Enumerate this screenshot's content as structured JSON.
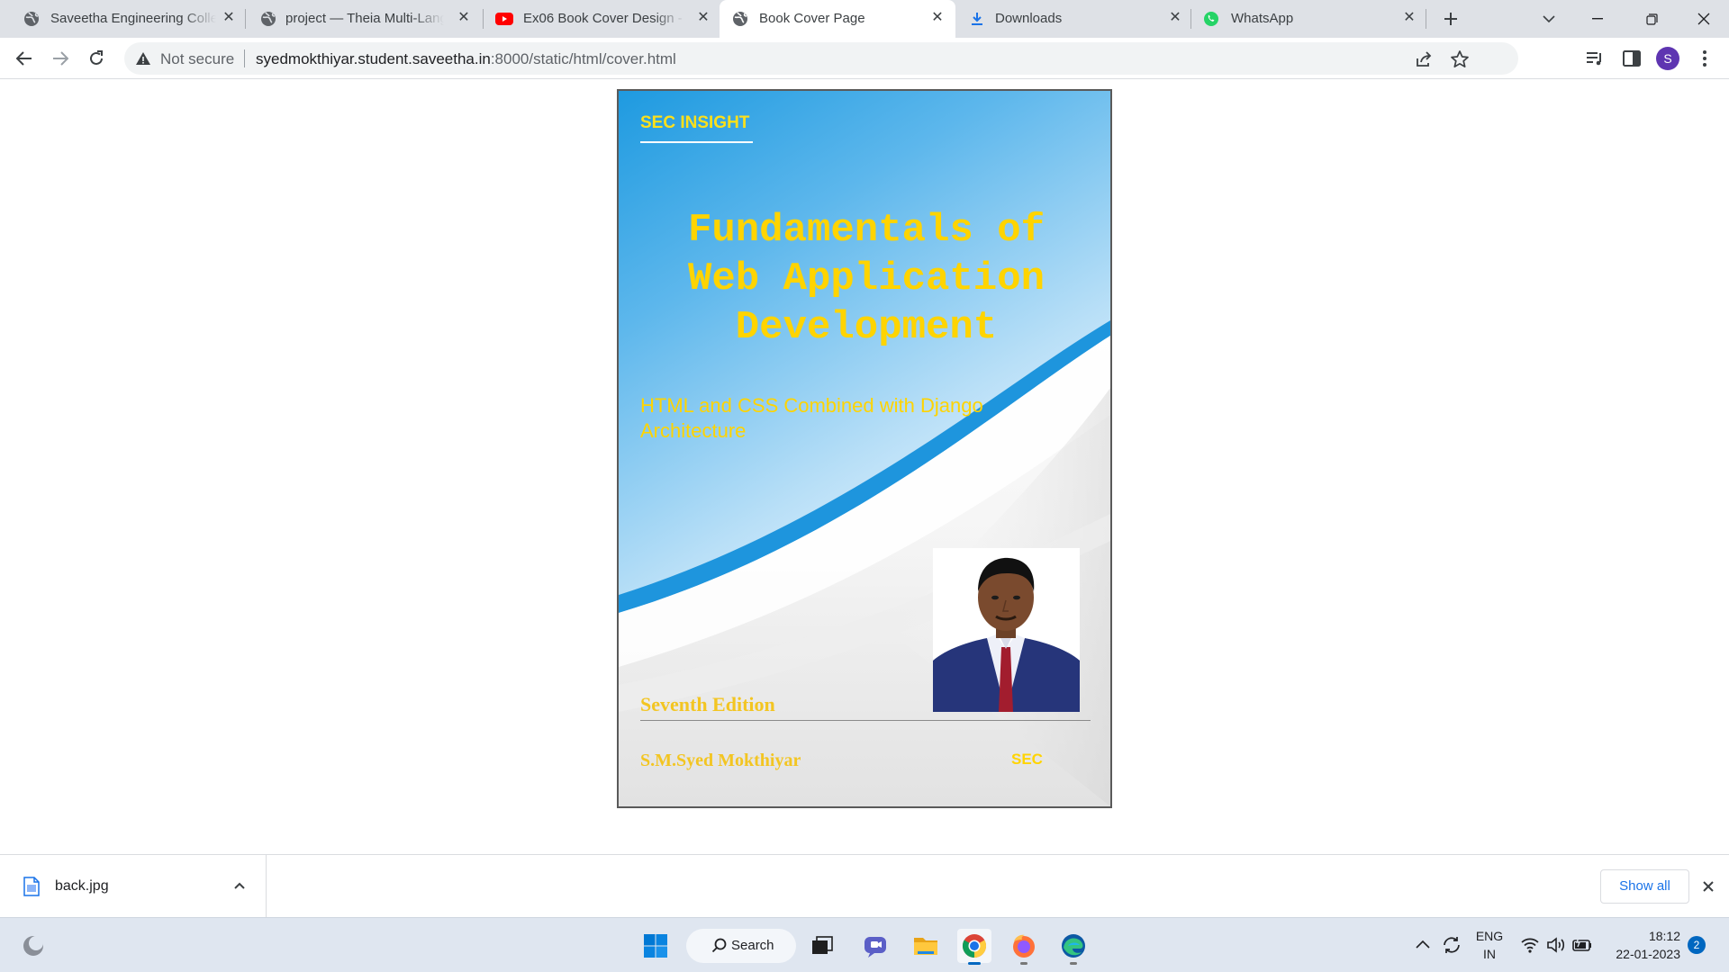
{
  "browser": {
    "tabs": [
      {
        "title": "Saveetha Engineering Colle",
        "icon": "globe-icon"
      },
      {
        "title": "project — Theia Multi-Lang",
        "icon": "globe-icon"
      },
      {
        "title": "Ex06 Book Cover Design - Y",
        "icon": "youtube-icon"
      },
      {
        "title": "Book Cover Page",
        "icon": "globe-icon",
        "active": true
      },
      {
        "title": "Downloads",
        "icon": "download-icon"
      },
      {
        "title": "WhatsApp",
        "icon": "whatsapp-icon"
      }
    ],
    "security_label": "Not secure",
    "url_host": "syedmokthiyar.student.saveetha.in",
    "url_path": ":8000/static/html/cover.html",
    "profile_initial": "S",
    "accent_color": "#5e35b1"
  },
  "cover": {
    "brand": "SEC INSIGHT",
    "title": "Fundamentals of Web Application Development",
    "subtitle": "HTML and CSS Combined with Django Architecture",
    "edition": "Seventh Edition",
    "author": "S.M.Syed Mokthiyar",
    "publisher": "SEC",
    "title_color": "#ffd400",
    "wave_color": "#1e95dd"
  },
  "downloads": {
    "file_name": "back.jpg",
    "show_all_label": "Show all"
  },
  "taskbar": {
    "search_label": "Search",
    "lang_line1": "ENG",
    "lang_line2": "IN",
    "time": "18:12",
    "date": "22-01-2023",
    "notification_count": "2"
  }
}
